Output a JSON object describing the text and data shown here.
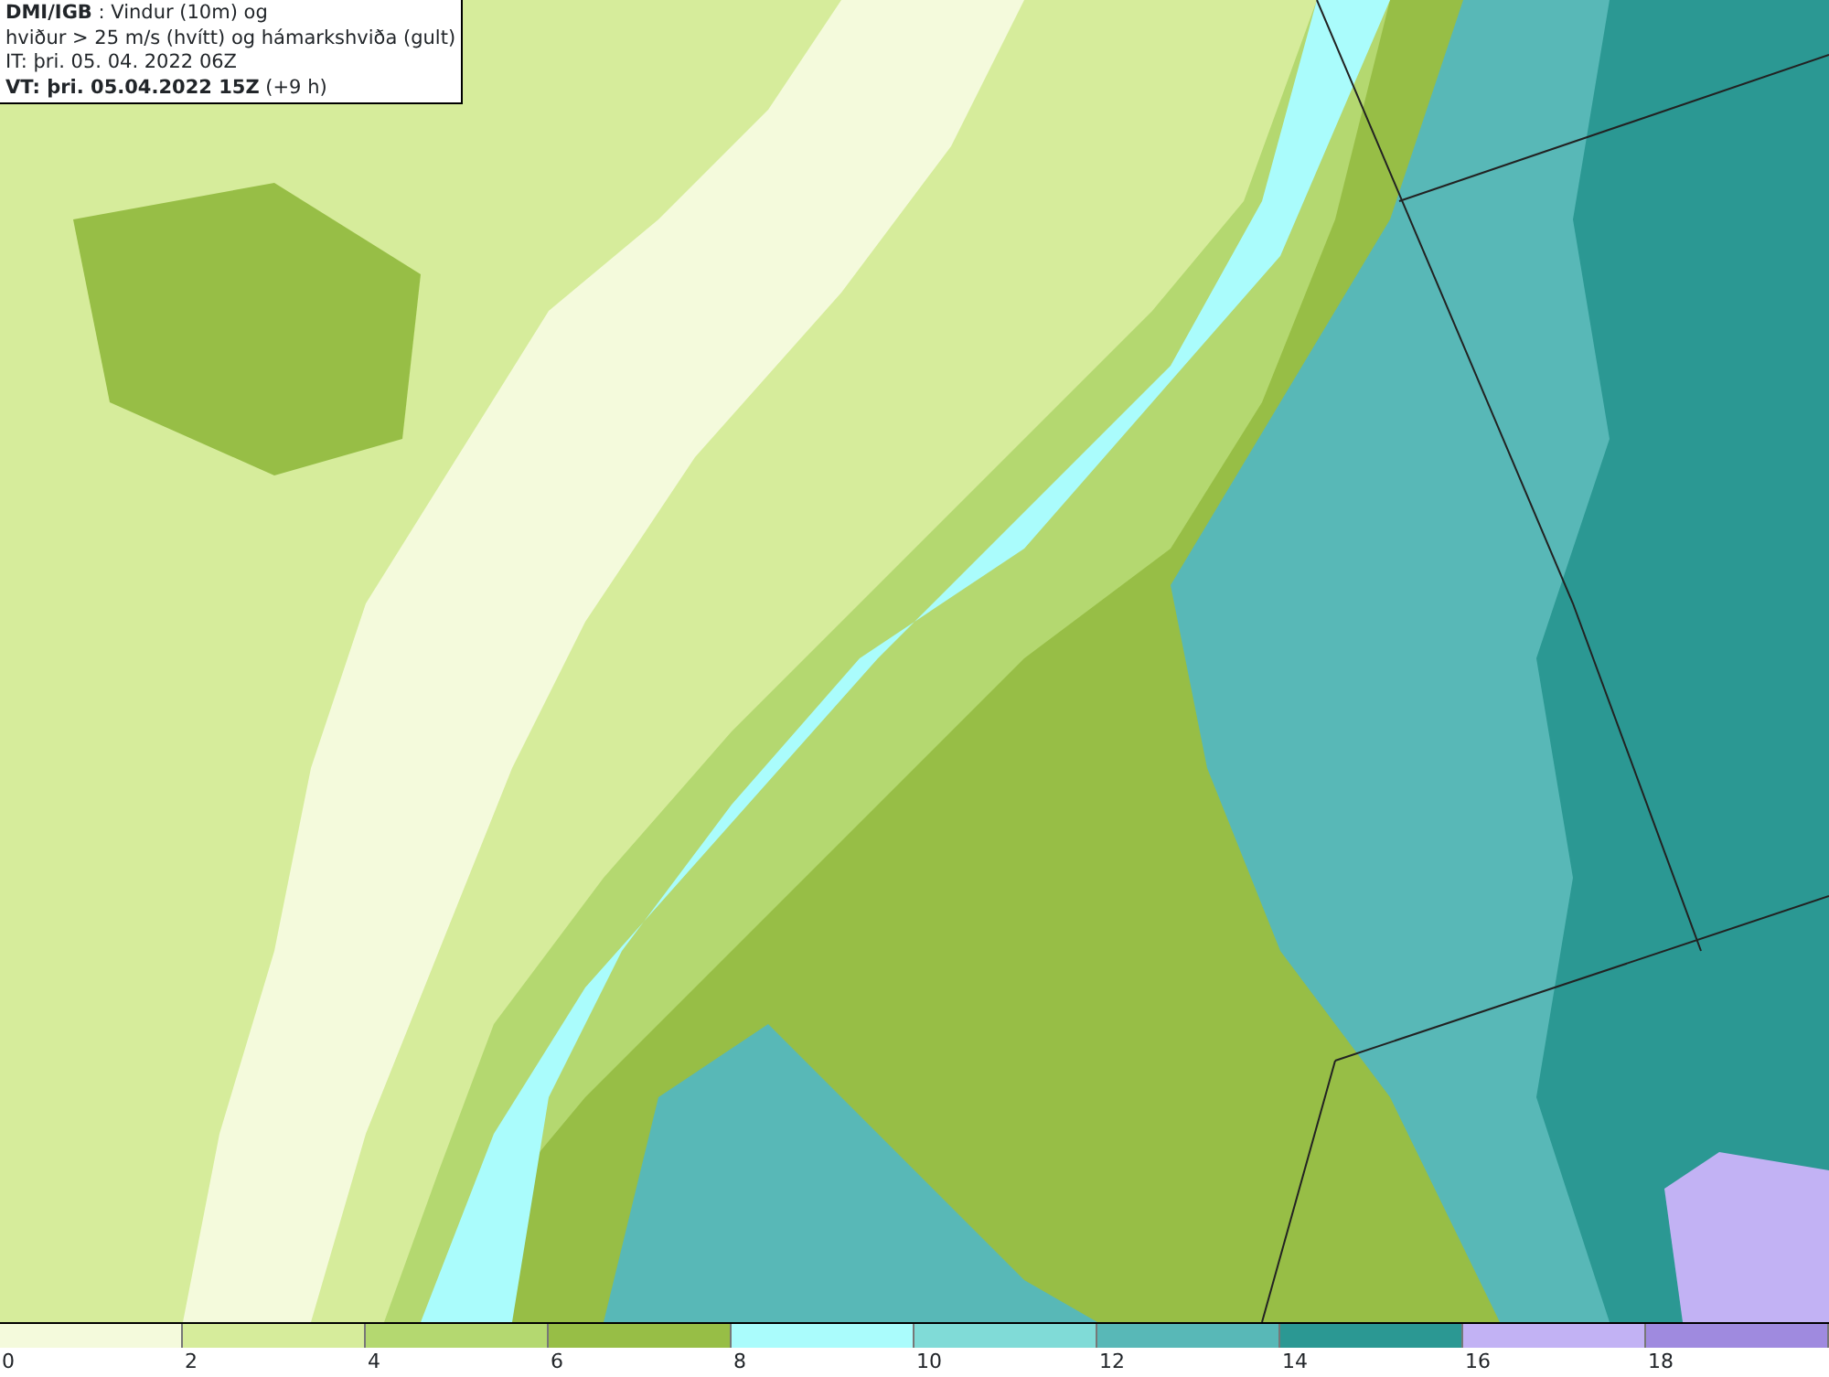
{
  "header": {
    "lines": [
      "**DMI/IGB** : Vindur (10m) og",
      "hviður > 25 m/s (hvítt) og hámarkshviða (gult)",
      "IT: þri. 05. 04. 2022 06Z",
      "**VT: þri. 05.04.2022 15Z** (+9 h)"
    ]
  },
  "legend": [
    {
      "label": "0",
      "color": "#f4fadc"
    },
    {
      "label": "2",
      "color": "#d6ec9b"
    },
    {
      "label": "4",
      "color": "#b4d870"
    },
    {
      "label": "6",
      "color": "#97be46"
    },
    {
      "label": "8",
      "color": "#aafcfc"
    },
    {
      "label": "10",
      "color": "#80dbd7"
    },
    {
      "label": "12",
      "color": "#58b8b7"
    },
    {
      "label": "14",
      "color": "#2b9893"
    },
    {
      "label": "16",
      "color": "#c2b2f4"
    },
    {
      "label": "18",
      "color": "#9f8adf"
    }
  ]
}
